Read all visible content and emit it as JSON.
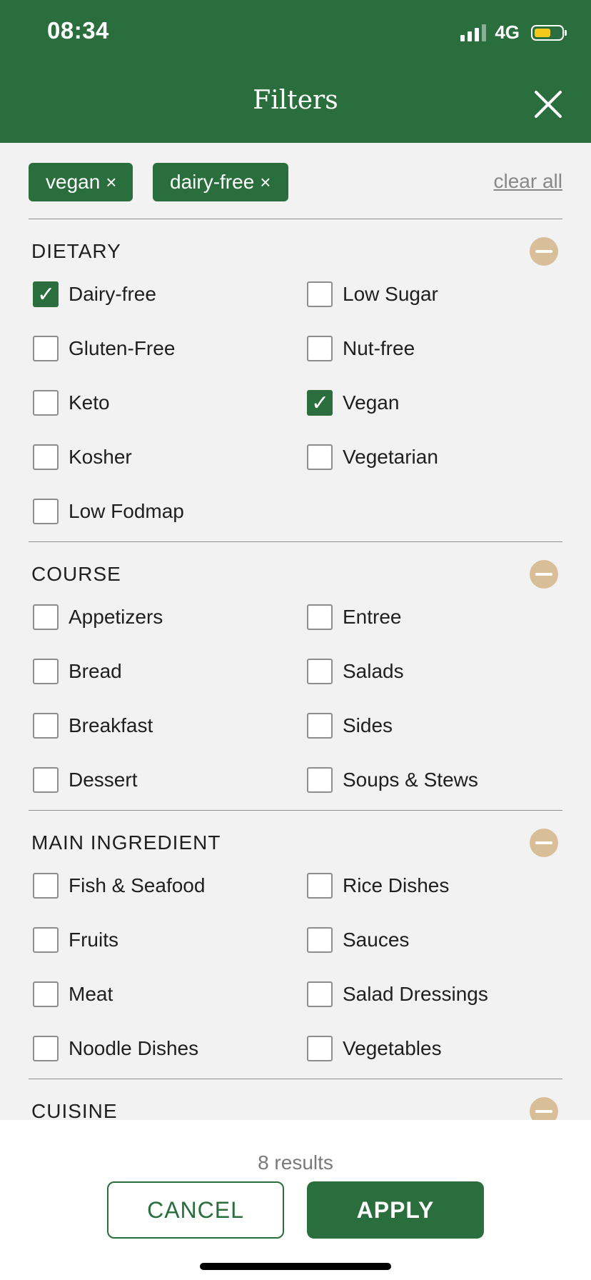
{
  "status_bar": {
    "time": "08:34",
    "network": "4G"
  },
  "header": {
    "title": "Filters"
  },
  "active_filters": {
    "chips": [
      {
        "label": "vegan",
        "remove_icon": "×"
      },
      {
        "label": "dairy-free",
        "remove_icon": "×"
      }
    ],
    "clear_all": "clear all"
  },
  "sections": {
    "dietary": {
      "title": "DIETARY",
      "options": {
        "dairy_free": "Dairy-free",
        "low_sugar": "Low Sugar",
        "gluten_free": "Gluten-Free",
        "nut_free": "Nut-free",
        "keto": "Keto",
        "vegan": "Vegan",
        "kosher": "Kosher",
        "vegetarian": "Vegetarian",
        "low_fodmap": "Low Fodmap"
      },
      "checked": [
        "Dairy-free",
        "Vegan"
      ]
    },
    "course": {
      "title": "COURSE",
      "options": {
        "appetizers": "Appetizers",
        "entree": "Entree",
        "bread": "Bread",
        "salads": "Salads",
        "breakfast": "Breakfast",
        "sides": "Sides",
        "dessert": "Dessert",
        "soups": "Soups & Stews"
      }
    },
    "main_ingredient": {
      "title": "MAIN INGREDIENT",
      "options": {
        "fish": "Fish & Seafood",
        "rice": "Rice Dishes",
        "fruits": "Fruits",
        "sauces": "Sauces",
        "meat": "Meat",
        "salad_dressings": "Salad Dressings",
        "noodle": "Noodle Dishes",
        "vegetables": "Vegetables"
      }
    },
    "cuisine": {
      "title": "CUISINE"
    }
  },
  "footer": {
    "results": "8 results",
    "cancel_label": "CANCEL",
    "apply_label": "APPLY"
  },
  "icons": {
    "close": "close-icon",
    "collapse": "minus-circle-icon",
    "checkbox_checked": "checkmark-icon"
  },
  "colors": {
    "brand_green": "#2b6e3e",
    "collapse_tan": "#d9bf99",
    "battery_yellow": "#f6c81b"
  }
}
